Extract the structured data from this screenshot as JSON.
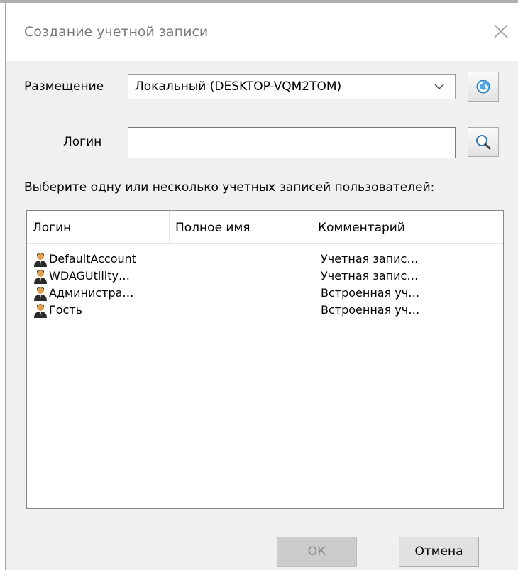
{
  "dialog": {
    "title": "Создание учетной записи"
  },
  "location": {
    "label": "Размещение",
    "value": "Локальный (DESKTOP-VQM2TOM)"
  },
  "login": {
    "label": "Логин",
    "value": ""
  },
  "instruction": "Выберите одну или несколько учетных записей пользователей:",
  "table": {
    "columns": [
      "Логин",
      "Полное имя",
      "Комментарий"
    ],
    "rows": [
      {
        "login": "DefaultAccount",
        "full_name": "",
        "comment": "Учетная запис…"
      },
      {
        "login": "WDAGUtility…",
        "full_name": "",
        "comment": "Учетная запис…"
      },
      {
        "login": "Администра…",
        "full_name": "",
        "comment": "Встроенная уч…"
      },
      {
        "login": "Гость",
        "full_name": "",
        "comment": "Встроенная уч…"
      }
    ]
  },
  "buttons": {
    "ok": "ОК",
    "cancel": "Отмена"
  },
  "icons": {
    "refresh": "refresh-icon",
    "search": "search-icon",
    "user": "user-icon",
    "close": "close-icon",
    "dropdown": "chevron-down-icon"
  },
  "colors": {
    "accent": "#2a8fd4",
    "disabled_button": "#cccccc"
  }
}
